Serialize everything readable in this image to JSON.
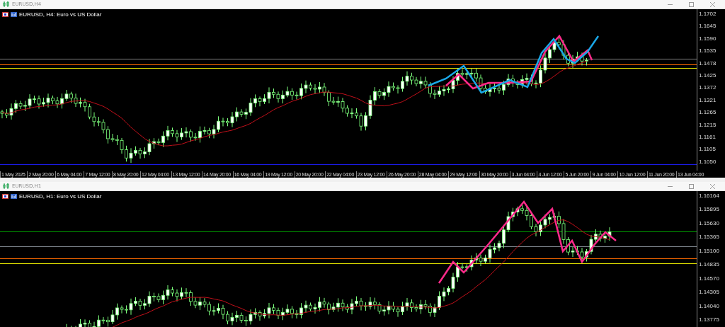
{
  "windows": [
    {
      "title": "EURUSD,H4",
      "chart_header": "EURUSD, H4:  Euro vs US Dollar",
      "kind": "h4",
      "price_labels": [
        "1.1702",
        "1.1645",
        "1.1590",
        "1.1535",
        "1.1478",
        "1.1425",
        "1.1372",
        "1.1321",
        "1.1265",
        "1.1215",
        "1.1161",
        "1.1105",
        "1.1050"
      ],
      "level_lines": [
        {
          "color": "#808080"
        },
        {
          "color": "#ff6a00"
        },
        {
          "color": "#e8e800"
        },
        {
          "color": "#1a1ae6"
        }
      ],
      "time_labels": [
        "1 May 2025",
        "2 May 20:00",
        "6 May 04:00",
        "7 May 12:00",
        "8 May 20:00",
        "12 May 04:00",
        "13 May 12:00",
        "14 May 20:00",
        "16 May 04:00",
        "19 May 12:00",
        "20 May 20:00",
        "22 May 04:00",
        "23 May 12:00",
        "26 May 20:00",
        "28 May 04:00",
        "29 May 12:00",
        "30 May 20:00",
        "3 Jun 04:00",
        "4 Jun 12:00",
        "5 Jun 20:00",
        "9 Jun 04:00",
        "10 Jun 12:00",
        "11 Jun 20:00",
        "13 Jun 04:00"
      ]
    },
    {
      "title": "EURUSD,H1",
      "chart_header": "EURUSD, H1:  Euro vs US Dollar",
      "kind": "h1",
      "price_labels": [
        "1.16164",
        "1.15895",
        "1.15630",
        "1.15365",
        "1.15100",
        "1.14835",
        "1.14570",
        "1.14305",
        "1.14040",
        "1.13775"
      ],
      "level_lines": [
        {
          "color": "#00a000"
        },
        {
          "color": "#808890"
        },
        {
          "color": "#ff6a00"
        },
        {
          "color": "#e8e800"
        }
      ]
    }
  ]
}
